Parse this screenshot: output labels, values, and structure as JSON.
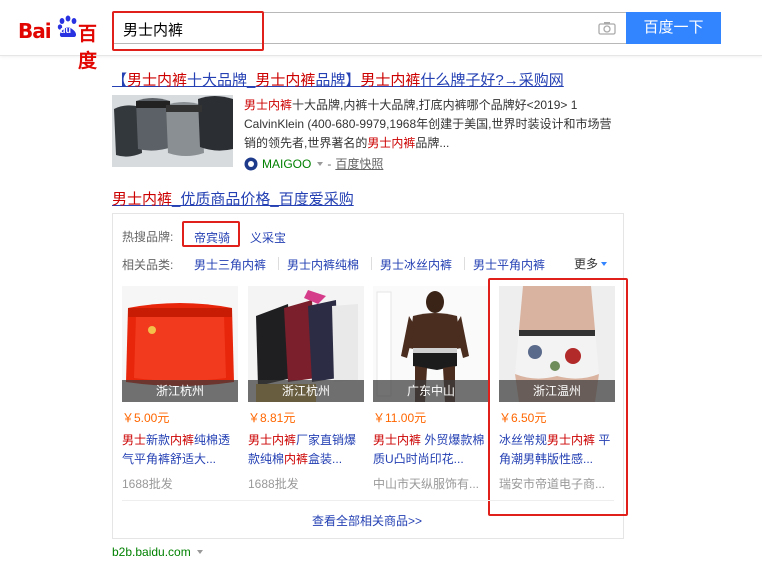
{
  "logo": {
    "latin": "Bai",
    "du": "du",
    "chinese": "百度"
  },
  "search": {
    "query": "男士内裤",
    "button_label": "百度一下"
  },
  "result1": {
    "title_parts": [
      "【",
      "男士内裤",
      "十大品牌_",
      "男士内裤",
      "品牌】",
      "男士内裤",
      "什么牌子好?→采购网"
    ],
    "abstract_parts": [
      "男士内裤",
      "十大品牌,内裤十大品牌,打底内裤哪个品牌好<2019> 1 CalvinKlein (400-680-9979,1968年创建于美国,世界时装设计和市场营销的领先者,世界著名的",
      "男士内裤",
      "品牌..."
    ],
    "source_site": "MAIGOO",
    "snapshot": "百度快照"
  },
  "result2": {
    "title_parts": [
      "男士内裤",
      "_优质商品价格_百度爱采购"
    ],
    "hot_brands_label": "热搜品牌:",
    "hot_brands": [
      "帝宾骑",
      "义采宝"
    ],
    "related_label": "相关品类:",
    "categories": [
      "男士三角内裤",
      "男士内裤纯棉",
      "男士冰丝内裤",
      "男士平角内裤"
    ],
    "more_label": "更多",
    "products": [
      {
        "location": "浙江杭州",
        "price": "￥5.00元",
        "title_parts": [
          "男士",
          "新款",
          "内裤",
          "纯棉透气平角裤舒适大..."
        ],
        "shop": "1688批发"
      },
      {
        "location": "浙江杭州",
        "price": "￥8.81元",
        "title_parts": [
          "男士内裤",
          "厂家直销爆款纯棉",
          "内裤",
          "盒装..."
        ],
        "shop": "1688批发"
      },
      {
        "location": "广东中山",
        "price": "￥11.00元",
        "title_parts": [
          "男士内裤",
          " 外贸爆款棉质U凸时尚印花..."
        ],
        "shop": "中山市天纵服饰有..."
      },
      {
        "location": "浙江温州",
        "price": "￥6.50元",
        "title_parts": [
          "冰丝常规",
          "男士内裤",
          " 平角潮男韩版性感..."
        ],
        "shop": "瑞安市帝道电子商..."
      }
    ],
    "view_all": "查看全部相关商品>>",
    "url": "b2b.baidu.com"
  },
  "colors": {
    "link": "#2440b3",
    "highlight_red": "#c00",
    "price": "#f60",
    "button": "#3385ff",
    "annotation": "#e0201b",
    "source_green": "#008000"
  }
}
